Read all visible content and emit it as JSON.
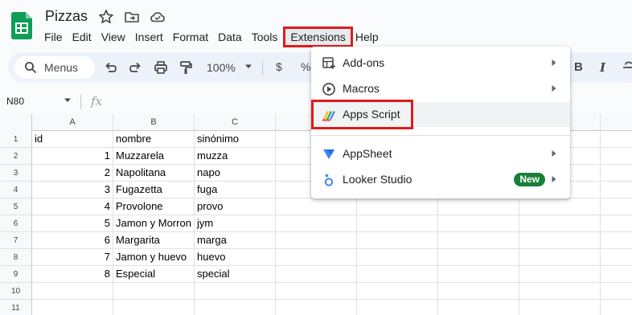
{
  "document": {
    "title": "Pizzas"
  },
  "menubar": {
    "items": [
      {
        "label": "File"
      },
      {
        "label": "Edit"
      },
      {
        "label": "View"
      },
      {
        "label": "Insert"
      },
      {
        "label": "Format"
      },
      {
        "label": "Data"
      },
      {
        "label": "Tools"
      },
      {
        "label": "Extensions"
      },
      {
        "label": "Help"
      }
    ]
  },
  "toolbar": {
    "search_label": "Menus",
    "zoom": "100%",
    "currency": "$",
    "percent": "%",
    "bold": "B",
    "italic": "I"
  },
  "formula_bar": {
    "cell_ref": "N80",
    "fx": "fx"
  },
  "grid": {
    "columns": [
      "A",
      "B",
      "C"
    ],
    "row_numbers": [
      "1",
      "2",
      "3",
      "4",
      "5",
      "6",
      "7",
      "8",
      "9",
      "10",
      "11"
    ],
    "rows": [
      {
        "a": "id",
        "b": "nombre",
        "c": "sinónimo"
      },
      {
        "a": "1",
        "b": "Muzzarela",
        "c": "muzza"
      },
      {
        "a": "2",
        "b": "Napolitana",
        "c": "napo"
      },
      {
        "a": "3",
        "b": "Fugazetta",
        "c": "fuga"
      },
      {
        "a": "4",
        "b": "Provolone",
        "c": "provo"
      },
      {
        "a": "5",
        "b": "Jamon y Morron",
        "c": "jym"
      },
      {
        "a": "6",
        "b": "Margarita",
        "c": "marga"
      },
      {
        "a": "7",
        "b": "Jamon y huevo",
        "c": "huevo"
      },
      {
        "a": "8",
        "b": "Especial",
        "c": "special"
      },
      {
        "a": "",
        "b": "",
        "c": ""
      },
      {
        "a": "",
        "b": "",
        "c": ""
      }
    ]
  },
  "extensions_menu": {
    "items": [
      {
        "label": "Add-ons",
        "icon": "addons-icon"
      },
      {
        "label": "Macros",
        "icon": "macros-icon"
      },
      {
        "label": "Apps Script",
        "icon": "apps-script-icon"
      },
      {
        "label": "AppSheet",
        "icon": "appsheet-icon"
      },
      {
        "label": "Looker Studio",
        "icon": "looker-studio-icon",
        "badge": "New"
      }
    ]
  },
  "colors": {
    "highlight": "#e01b1b",
    "badge": "#188038",
    "sheets_green": "#188038"
  }
}
